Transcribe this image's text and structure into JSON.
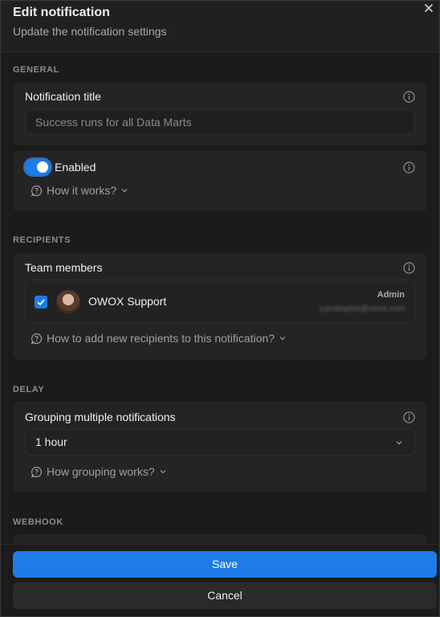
{
  "header": {
    "title": "Edit notification",
    "subtitle": "Update the notification settings"
  },
  "general": {
    "section_label": "GENERAL",
    "title_field": {
      "label": "Notification title",
      "placeholder": "Success runs for all Data Marts"
    },
    "enabled": {
      "label": "Enabled",
      "on": true,
      "help": "How it works?"
    }
  },
  "recipients": {
    "section_label": "RECIPIENTS",
    "team_label": "Team members",
    "members": [
      {
        "name": "OWOX Support",
        "role": "Admin",
        "email": "v.prokopets@owox.com",
        "checked": true
      }
    ],
    "help": "How to add new recipients to this notification?"
  },
  "delay": {
    "section_label": "DELAY",
    "label": "Grouping multiple notifications",
    "selected": "1 hour",
    "help": "How grouping works?"
  },
  "webhook": {
    "section_label": "WEBHOOK"
  },
  "footer": {
    "save_label": "Save",
    "cancel_label": "Cancel"
  },
  "colors": {
    "accent": "#1e7be8",
    "background": "#1b1b1b",
    "card": "#242424"
  }
}
